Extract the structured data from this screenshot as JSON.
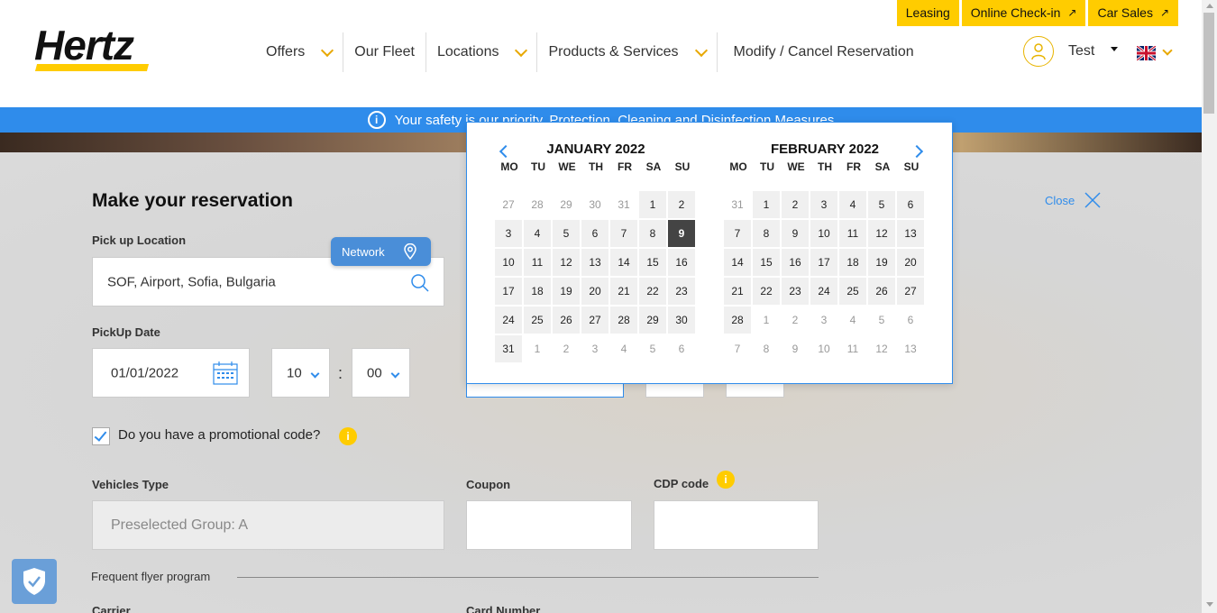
{
  "brand": {
    "logo": "Hertz",
    "accent": "#ffcc00",
    "blue": "#2f8ceb"
  },
  "top_links": [
    {
      "label": "Leasing",
      "external": false
    },
    {
      "label": "Online Check-in",
      "external": true
    },
    {
      "label": "Car Sales",
      "external": true
    }
  ],
  "nav": {
    "offers": "Offers",
    "fleet": "Our Fleet",
    "locations": "Locations",
    "products": "Products & Services",
    "modify": "Modify / Cancel Reservation"
  },
  "user": {
    "name": "Test",
    "language_flag": "uk-flag-icon"
  },
  "banner": {
    "text": "Your safety is our priority. Protection, Cleaning and Disinfection Measures"
  },
  "reservation": {
    "title": "Make your reservation",
    "pickup_location_label": "Pick up Location",
    "pickup_location_value": "SOF, Airport, Sofia, Bulgaria",
    "network_label": "Network",
    "pickup_date_label": "PickUp Date",
    "pickup_date_value": "01/01/2022",
    "pickup_hour": "10",
    "pickup_minute": "00",
    "time_separator": ":",
    "close_label": "Close",
    "promo_label": "Do you have a promotional code?",
    "promo_checked": true,
    "vehicles_type_label": "Vehicles Type",
    "vehicles_type_value": "Preselected Group: A",
    "coupon_label": "Coupon",
    "cdp_label": "CDP code",
    "frequent_flyer_label": "Frequent flyer program",
    "carrier_label": "Carrier",
    "card_number_label": "Card Number"
  },
  "calendar": {
    "dow": [
      "MO",
      "TU",
      "WE",
      "TH",
      "FR",
      "SA",
      "SU"
    ],
    "months": [
      {
        "title": "JANUARY 2022",
        "weeks": [
          [
            {
              "d": "27",
              "o": true
            },
            {
              "d": "28",
              "o": true
            },
            {
              "d": "29",
              "o": true
            },
            {
              "d": "30",
              "o": true
            },
            {
              "d": "31",
              "o": true
            },
            {
              "d": "1"
            },
            {
              "d": "2"
            }
          ],
          [
            {
              "d": "3"
            },
            {
              "d": "4"
            },
            {
              "d": "5"
            },
            {
              "d": "6"
            },
            {
              "d": "7"
            },
            {
              "d": "8"
            },
            {
              "d": "9",
              "s": true
            }
          ],
          [
            {
              "d": "10"
            },
            {
              "d": "11"
            },
            {
              "d": "12"
            },
            {
              "d": "13"
            },
            {
              "d": "14"
            },
            {
              "d": "15"
            },
            {
              "d": "16"
            }
          ],
          [
            {
              "d": "17"
            },
            {
              "d": "18"
            },
            {
              "d": "19"
            },
            {
              "d": "20"
            },
            {
              "d": "21"
            },
            {
              "d": "22"
            },
            {
              "d": "23"
            }
          ],
          [
            {
              "d": "24"
            },
            {
              "d": "25"
            },
            {
              "d": "26"
            },
            {
              "d": "27"
            },
            {
              "d": "28"
            },
            {
              "d": "29"
            },
            {
              "d": "30"
            }
          ],
          [
            {
              "d": "31"
            },
            {
              "d": "1",
              "o": true
            },
            {
              "d": "2",
              "o": true
            },
            {
              "d": "3",
              "o": true
            },
            {
              "d": "4",
              "o": true
            },
            {
              "d": "5",
              "o": true
            },
            {
              "d": "6",
              "o": true
            }
          ]
        ]
      },
      {
        "title": "FEBRUARY 2022",
        "weeks": [
          [
            {
              "d": "31",
              "o": true
            },
            {
              "d": "1"
            },
            {
              "d": "2"
            },
            {
              "d": "3"
            },
            {
              "d": "4"
            },
            {
              "d": "5"
            },
            {
              "d": "6"
            }
          ],
          [
            {
              "d": "7"
            },
            {
              "d": "8"
            },
            {
              "d": "9"
            },
            {
              "d": "10"
            },
            {
              "d": "11"
            },
            {
              "d": "12"
            },
            {
              "d": "13"
            }
          ],
          [
            {
              "d": "14"
            },
            {
              "d": "15"
            },
            {
              "d": "16"
            },
            {
              "d": "17"
            },
            {
              "d": "18"
            },
            {
              "d": "19"
            },
            {
              "d": "20"
            }
          ],
          [
            {
              "d": "21"
            },
            {
              "d": "22"
            },
            {
              "d": "23"
            },
            {
              "d": "24"
            },
            {
              "d": "25"
            },
            {
              "d": "26"
            },
            {
              "d": "27"
            }
          ],
          [
            {
              "d": "28"
            },
            {
              "d": "1",
              "o": true
            },
            {
              "d": "2",
              "o": true
            },
            {
              "d": "3",
              "o": true
            },
            {
              "d": "4",
              "o": true
            },
            {
              "d": "5",
              "o": true
            },
            {
              "d": "6",
              "o": true
            }
          ],
          [
            {
              "d": "7",
              "o": true
            },
            {
              "d": "8",
              "o": true
            },
            {
              "d": "9",
              "o": true
            },
            {
              "d": "10",
              "o": true
            },
            {
              "d": "11",
              "o": true
            },
            {
              "d": "12",
              "o": true
            },
            {
              "d": "13",
              "o": true
            }
          ]
        ]
      }
    ]
  }
}
